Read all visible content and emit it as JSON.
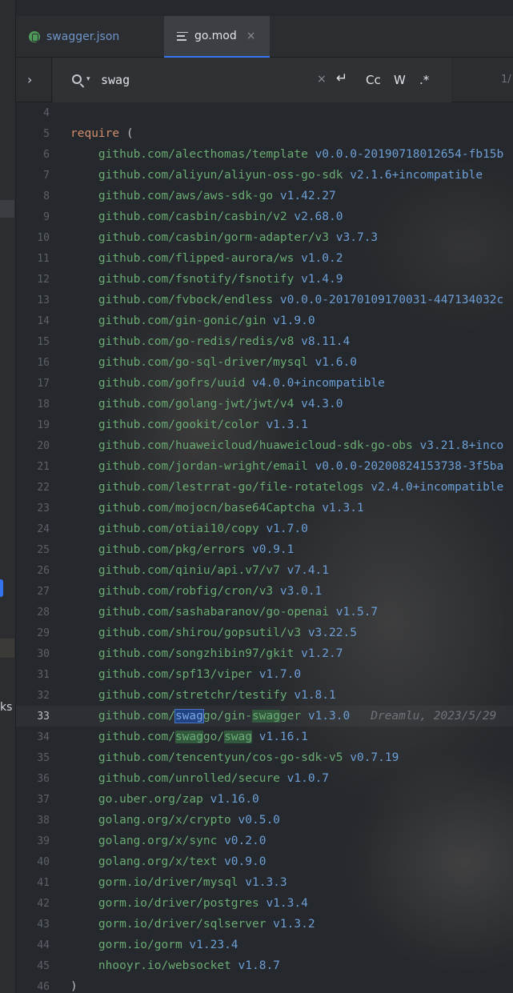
{
  "tabs": [
    {
      "label": "swagger.json",
      "icon": "json-file-icon",
      "active": false
    },
    {
      "label": "go.mod",
      "icon": "go-mod-file-icon",
      "active": true,
      "close": "×"
    }
  ],
  "search": {
    "query": "swag",
    "clear": "×",
    "options": {
      "newline": "↵",
      "match_case": "Cc",
      "words": "W",
      "regex": ".*"
    },
    "count": "1/"
  },
  "left_strip": {
    "label": "ks"
  },
  "colors": {
    "keyword": "#cf8e6d",
    "package": "#6aab73",
    "version": "#6d9fd6",
    "match_highlight": "#32593d",
    "current_match": "#214283"
  },
  "lines": [
    {
      "n": "4",
      "kind": "blank"
    },
    {
      "n": "5",
      "kind": "require",
      "kw": "require",
      "rest": " ("
    },
    {
      "n": "6",
      "kind": "dep",
      "pkg": "github.com/alecthomas/template",
      "ver": "v0.0.0-20190718012654-fb15b"
    },
    {
      "n": "7",
      "kind": "dep",
      "pkg": "github.com/aliyun/aliyun-oss-go-sdk",
      "ver": "v2.1.6+incompatible"
    },
    {
      "n": "8",
      "kind": "dep",
      "pkg": "github.com/aws/aws-sdk-go",
      "ver": "v1.42.27"
    },
    {
      "n": "9",
      "kind": "dep",
      "pkg": "github.com/casbin/casbin/v2",
      "ver": "v2.68.0"
    },
    {
      "n": "10",
      "kind": "dep",
      "pkg": "github.com/casbin/gorm-adapter/v3",
      "ver": "v3.7.3"
    },
    {
      "n": "11",
      "kind": "dep",
      "pkg": "github.com/flipped-aurora/ws",
      "ver": "v1.0.2"
    },
    {
      "n": "12",
      "kind": "dep",
      "pkg": "github.com/fsnotify/fsnotify",
      "ver": "v1.4.9"
    },
    {
      "n": "13",
      "kind": "dep",
      "pkg": "github.com/fvbock/endless",
      "ver": "v0.0.0-20170109170031-447134032c"
    },
    {
      "n": "14",
      "kind": "dep",
      "pkg": "github.com/gin-gonic/gin",
      "ver": "v1.9.0"
    },
    {
      "n": "15",
      "kind": "dep",
      "pkg": "github.com/go-redis/redis/v8",
      "ver": "v8.11.4"
    },
    {
      "n": "16",
      "kind": "dep",
      "pkg": "github.com/go-sql-driver/mysql",
      "ver": "v1.6.0"
    },
    {
      "n": "17",
      "kind": "dep",
      "pkg": "github.com/gofrs/uuid",
      "ver": "v4.0.0+incompatible"
    },
    {
      "n": "18",
      "kind": "dep",
      "pkg": "github.com/golang-jwt/jwt/v4",
      "ver": "v4.3.0"
    },
    {
      "n": "19",
      "kind": "dep",
      "pkg": "github.com/gookit/color",
      "ver": "v1.3.1"
    },
    {
      "n": "20",
      "kind": "dep",
      "pkg": "github.com/huaweicloud/huaweicloud-sdk-go-obs",
      "ver": "v3.21.8+inco"
    },
    {
      "n": "21",
      "kind": "dep",
      "pkg": "github.com/jordan-wright/email",
      "ver": "v0.0.0-20200824153738-3f5ba"
    },
    {
      "n": "22",
      "kind": "dep",
      "pkg": "github.com/lestrrat-go/file-rotatelogs",
      "ver": "v2.4.0+incompatible"
    },
    {
      "n": "23",
      "kind": "dep",
      "pkg": "github.com/mojocn/base64Captcha",
      "ver": "v1.3.1"
    },
    {
      "n": "24",
      "kind": "dep",
      "pkg": "github.com/otiai10/copy",
      "ver": "v1.7.0"
    },
    {
      "n": "25",
      "kind": "dep",
      "pkg": "github.com/pkg/errors",
      "ver": "v0.9.1"
    },
    {
      "n": "26",
      "kind": "dep",
      "pkg": "github.com/qiniu/api.v7/v7",
      "ver": "v7.4.1"
    },
    {
      "n": "27",
      "kind": "dep",
      "pkg": "github.com/robfig/cron/v3",
      "ver": "v3.0.1"
    },
    {
      "n": "28",
      "kind": "dep",
      "pkg": "github.com/sashabaranov/go-openai",
      "ver": "v1.5.7"
    },
    {
      "n": "29",
      "kind": "dep",
      "pkg": "github.com/shirou/gopsutil/v3",
      "ver": "v3.22.5"
    },
    {
      "n": "30",
      "kind": "dep",
      "pkg": "github.com/songzhibin97/gkit",
      "ver": "v1.2.7"
    },
    {
      "n": "31",
      "kind": "dep",
      "pkg": "github.com/spf13/viper",
      "ver": "v1.7.0"
    },
    {
      "n": "32",
      "kind": "dep",
      "pkg": "github.com/stretchr/testify",
      "ver": "v1.8.1"
    },
    {
      "n": "33",
      "kind": "match",
      "current": true,
      "segments": [
        {
          "t": "github.com/",
          "c": "pkg"
        },
        {
          "t": "swag",
          "c": "hl-cur"
        },
        {
          "t": "go/gin-",
          "c": "pkg"
        },
        {
          "t": "swag",
          "c": "hl"
        },
        {
          "t": "ger",
          "c": "pkg"
        },
        {
          "t": " ",
          "c": ""
        },
        {
          "t": "v1.3.0",
          "c": "ver"
        }
      ],
      "blame": "Dreamlu, 2023/5/29"
    },
    {
      "n": "34",
      "kind": "match",
      "segments": [
        {
          "t": "github.com/",
          "c": "pkg"
        },
        {
          "t": "swag",
          "c": "hl"
        },
        {
          "t": "go/",
          "c": "pkg"
        },
        {
          "t": "swag",
          "c": "hl"
        },
        {
          "t": " ",
          "c": ""
        },
        {
          "t": "v1.16.1",
          "c": "ver"
        }
      ]
    },
    {
      "n": "35",
      "kind": "dep",
      "pkg": "github.com/tencentyun/cos-go-sdk-v5",
      "ver": "v0.7.19"
    },
    {
      "n": "36",
      "kind": "dep",
      "pkg": "github.com/unrolled/secure",
      "ver": "v1.0.7"
    },
    {
      "n": "37",
      "kind": "dep",
      "pkg": "go.uber.org/zap",
      "ver": "v1.16.0"
    },
    {
      "n": "38",
      "kind": "dep",
      "pkg": "golang.org/x/crypto",
      "ver": "v0.5.0"
    },
    {
      "n": "39",
      "kind": "dep",
      "pkg": "golang.org/x/sync",
      "ver": "v0.2.0"
    },
    {
      "n": "40",
      "kind": "dep",
      "pkg": "golang.org/x/text",
      "ver": "v0.9.0"
    },
    {
      "n": "41",
      "kind": "dep",
      "pkg": "gorm.io/driver/mysql",
      "ver": "v1.3.3"
    },
    {
      "n": "42",
      "kind": "dep",
      "pkg": "gorm.io/driver/postgres",
      "ver": "v1.3.4"
    },
    {
      "n": "43",
      "kind": "dep",
      "pkg": "gorm.io/driver/sqlserver",
      "ver": "v1.3.2"
    },
    {
      "n": "44",
      "kind": "dep",
      "pkg": "gorm.io/gorm",
      "ver": "v1.23.4"
    },
    {
      "n": "45",
      "kind": "dep",
      "pkg": "nhooyr.io/websocket",
      "ver": "v1.8.7"
    },
    {
      "n": "46",
      "kind": "close",
      "rest": ")"
    }
  ]
}
